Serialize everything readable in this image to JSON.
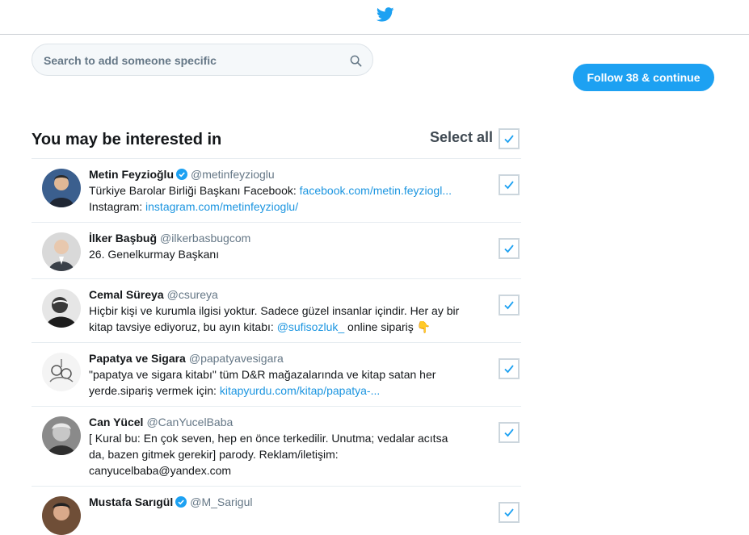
{
  "header": {
    "logo_icon": "twitter-bird-icon",
    "brand_color": "#1da1f2"
  },
  "search": {
    "placeholder": "Search to add someone specific",
    "icon": "search-icon"
  },
  "follow_button": {
    "label": "Follow 38 & continue"
  },
  "section": {
    "title": "You may be interested in",
    "select_all_label": "Select all",
    "select_all_checked": true
  },
  "accounts": [
    {
      "name": "Metin Feyzioğlu",
      "handle": "@metinfeyzioglu",
      "verified": true,
      "checked": true,
      "bio": [
        [
          {
            "t": "Türkiye Barolar Birliği Başkanı Facebook: "
          },
          {
            "t": "facebook.com/metin.feyziogl...",
            "link": true
          }
        ],
        [
          {
            "t": "Instagram: "
          },
          {
            "t": "instagram.com/metinfeyzioglu/",
            "link": true
          }
        ]
      ]
    },
    {
      "name": "İlker Başbuğ",
      "handle": "@ilkerbasbugcom",
      "verified": false,
      "checked": true,
      "bio": [
        [
          {
            "t": "26. Genelkurmay Başkanı"
          }
        ]
      ]
    },
    {
      "name": "Cemal Süreya",
      "handle": "@csureya",
      "verified": false,
      "checked": true,
      "bio": [
        [
          {
            "t": "Hiçbir kişi ve kurumla ilgisi yoktur. Sadece güzel insanlar içindir. Her ay bir"
          }
        ],
        [
          {
            "t": "kitap tavsiye ediyoruz, bu ayın kitabı: "
          },
          {
            "t": "@sufisozluk_",
            "link": true
          },
          {
            "t": " online sipariş 👇"
          }
        ]
      ]
    },
    {
      "name": "Papatya ve Sigara",
      "handle": "@papatyavesigara",
      "verified": false,
      "checked": true,
      "bio": [
        [
          {
            "t": "\"papatya ve sigara kitabı\" tüm D&R mağazalarında ve kitap satan her"
          }
        ],
        [
          {
            "t": "yerde.sipariş vermek için: "
          },
          {
            "t": "kitapyurdu.com/kitap/papatya-...",
            "link": true
          }
        ]
      ]
    },
    {
      "name": "Can Yücel",
      "handle": "@CanYucelBaba",
      "verified": false,
      "checked": true,
      "bio": [
        [
          {
            "t": "[ Kural bu: En çok seven, hep en önce terkedilir. Unutma; vedalar acıtsa"
          }
        ],
        [
          {
            "t": "da, bazen gitmek gerekir] parody. Reklam/iletişim:"
          }
        ],
        [
          {
            "t": "canyucelbaba@yandex.com"
          }
        ]
      ]
    },
    {
      "name": "Mustafa Sarıgül",
      "handle": "@M_Sarigul",
      "verified": true,
      "checked": true,
      "bio": []
    }
  ]
}
